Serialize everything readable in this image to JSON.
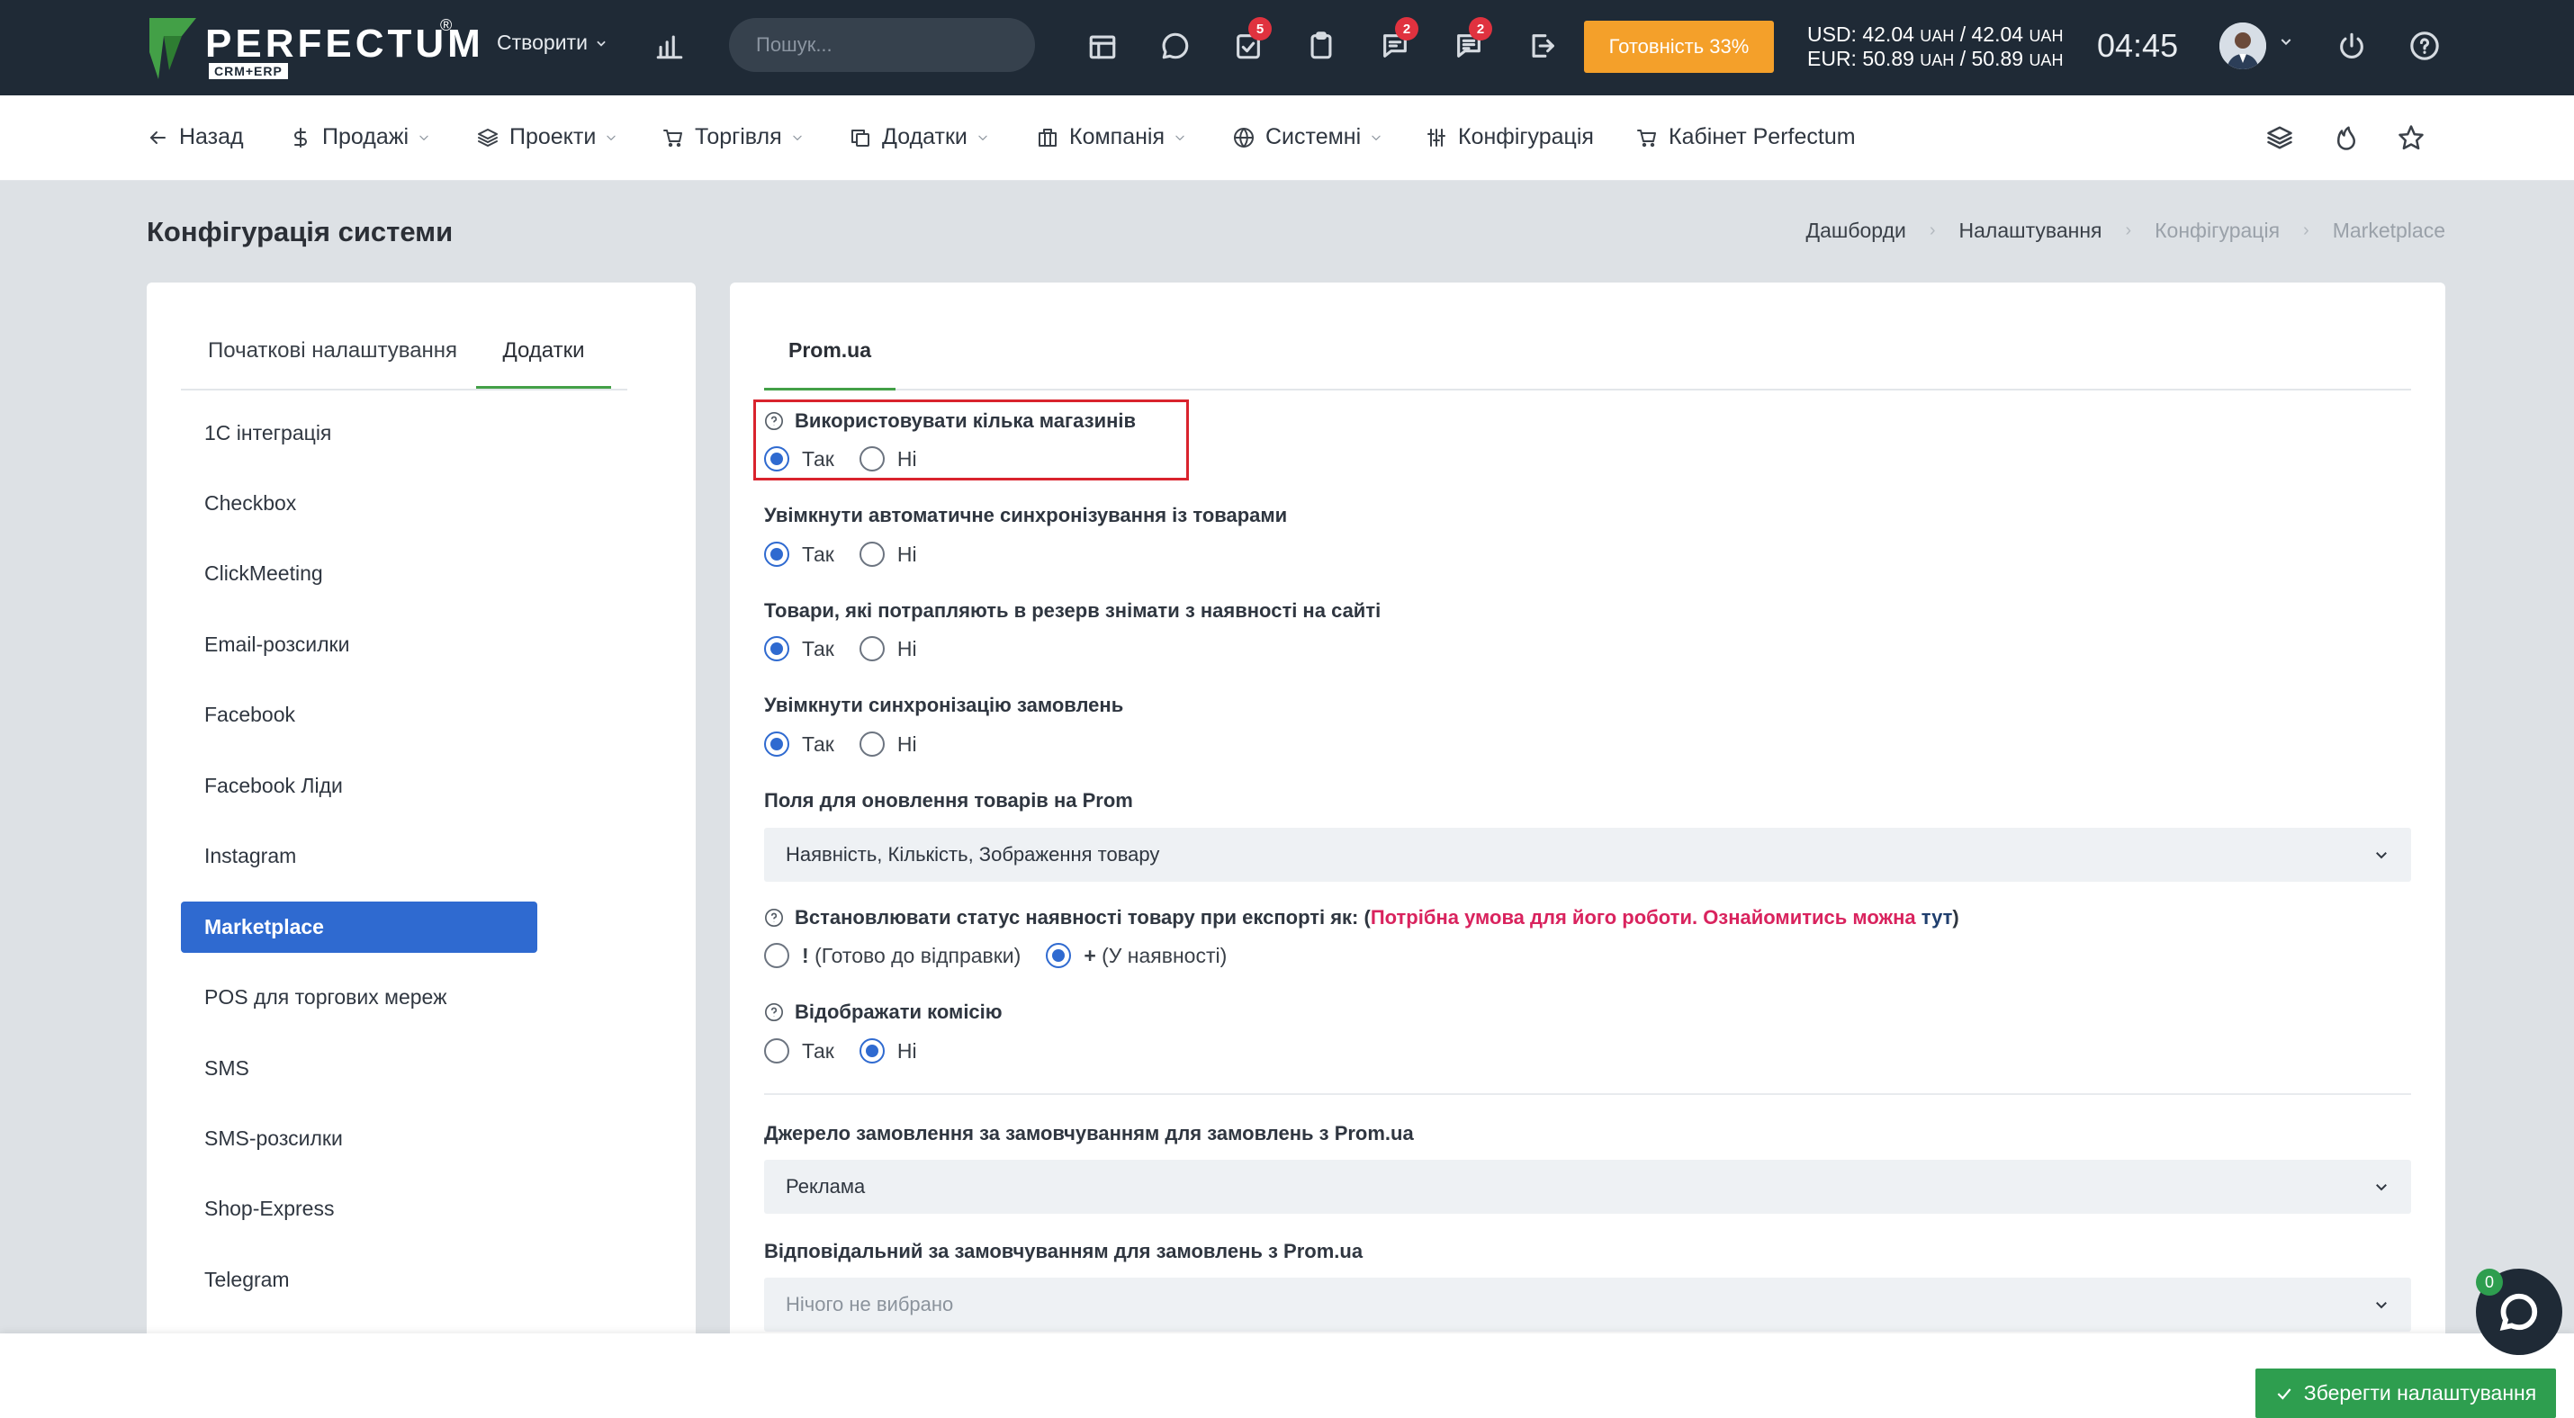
{
  "topbar": {
    "logo_text": "PERFECTUM",
    "logo_reg": "®",
    "logo_sub": "CRM+ERP",
    "create_label": "Створити",
    "search_placeholder": "Пошук...",
    "badges": {
      "tasks": "5",
      "chat2": "2",
      "messages": "2"
    },
    "ready_label": "Готовність 33%",
    "rates": {
      "usd": "USD: 42.04",
      "usd_unit1": "UAH",
      "usd_sep": "/ 42.04",
      "usd_unit2": "UAH",
      "eur": "EUR: 50.89",
      "eur_unit1": "UAH",
      "eur_sep": "/ 50.89",
      "eur_unit2": "UAH"
    },
    "clock": "04:45",
    "icons": [
      "bar-chart-icon",
      "calendar-icon",
      "chat-bubble-icon",
      "tasks-check-icon",
      "clipboard-icon",
      "messages-icon",
      "comments-icon",
      "logout-export-icon",
      "power-icon",
      "help-icon"
    ]
  },
  "menu": {
    "back": "Назад",
    "sales": "Продажі",
    "projects": "Проекти",
    "trade": "Торгівля",
    "addons": "Додатки",
    "company": "Компанія",
    "system": "Системні",
    "config": "Конфігурація",
    "cabinet": "Кабінет Perfectum"
  },
  "page": {
    "title": "Конфігурація системи",
    "breadcrumb": [
      "Дашборди",
      "Налаштування",
      "Конфігурація",
      "Marketplace"
    ]
  },
  "left": {
    "tabs": [
      "Початкові налаштування",
      "Додатки"
    ],
    "items": [
      "1С інтеграція",
      "Checkbox",
      "ClickMeeting",
      "Email-розсилки",
      "Facebook",
      "Facebook Ліди",
      "Instagram",
      "Marketplace",
      "POS для торгових мереж",
      "SMS",
      "SMS-розсилки",
      "Shop-Express",
      "Telegram"
    ],
    "active_index": 7
  },
  "right": {
    "tab": "Prom.ua",
    "yes": "Так",
    "no": "Ні",
    "f1_label": "Використовувати кілька магазинів",
    "f1_value": "Так",
    "f2_label": "Увімкнути автоматичне синхронізування із товарами",
    "f2_value": "Так",
    "f3_label": "Товари, які потрапляють в резерв знімати з наявності на сайті",
    "f3_value": "Так",
    "f4_label": "Увімкнути синхронізацію замовлень",
    "f4_value": "Так",
    "f5_label": "Поля для оновлення товарів на Prom",
    "f5_value": "Наявність, Кількість, Зображення товару",
    "f6_label_start": "Встановлювати статус наявності товару при експорті як: (",
    "f6_label_red": "Потрібна умова для його роботи. Ознайомитись можна",
    "f6_label_link": "тут",
    "f6_label_end": ")",
    "f6_opt1_mark": "!",
    "f6_opt1_text": "(Готово до відправки)",
    "f6_opt2_mark": "+",
    "f6_opt2_text": "(У наявності)",
    "f6_value": "+ (У наявності)",
    "f7_label": "Відображати комісію",
    "f7_value": "Ні",
    "f8_label": "Джерело замовлення за замовчуванням для замовлень з Prom.ua",
    "f8_value": "Реклама",
    "f9_label": "Відповідальний за замовчуванням для замовлень з Prom.ua",
    "f9_value": "Нічого не вибрано"
  },
  "footer": {
    "save_label": "Зберегти налаштування",
    "chat_badge": "0"
  },
  "colors": {
    "topbar": "#1f2a36",
    "accent_orange": "#f4a02a",
    "primary_blue": "#2f6ad0",
    "tab_green": "#43a047",
    "save_green": "#2e9e4f",
    "highlight_red": "#d9232d",
    "link_red": "#d9235e"
  }
}
